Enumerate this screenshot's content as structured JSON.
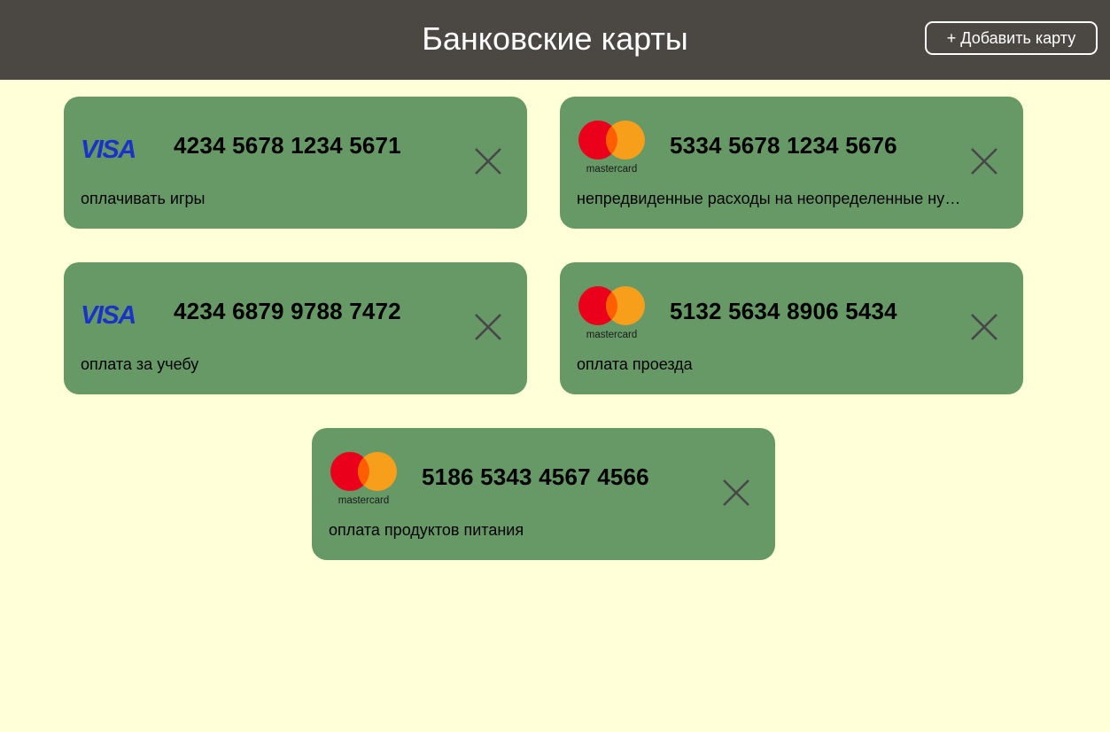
{
  "header": {
    "title": "Банковские карты",
    "add_button_label": "+ Добавить карту"
  },
  "colors": {
    "header_bg": "#4b4743",
    "page_bg": "#ffffd8",
    "card_bg": "#669966",
    "visa_blue": "#1a32c8",
    "mastercard_red": "#eb001b",
    "mastercard_orange": "#f79e1b"
  },
  "cards": [
    {
      "brand": "visa",
      "brand_label": "VISA",
      "number": "4234 5678 1234 5671",
      "note": "оплачивать игры",
      "remove_icon": "close-icon"
    },
    {
      "brand": "mastercard",
      "brand_label": "mastercard",
      "number": "5334 5678 1234 5676",
      "note": "непредвиденные расходы на неопределенные нужды",
      "remove_icon": "close-icon"
    },
    {
      "brand": "visa",
      "brand_label": "VISA",
      "number": "4234 6879 9788 7472",
      "note": "оплата за учебу",
      "remove_icon": "close-icon"
    },
    {
      "brand": "mastercard",
      "brand_label": "mastercard",
      "number": "5132 5634 8906 5434",
      "note": "оплата проезда",
      "remove_icon": "close-icon"
    },
    {
      "brand": "mastercard",
      "brand_label": "mastercard",
      "number": "5186 5343 4567 4566",
      "note": "оплата продуктов питания",
      "remove_icon": "close-icon"
    }
  ]
}
